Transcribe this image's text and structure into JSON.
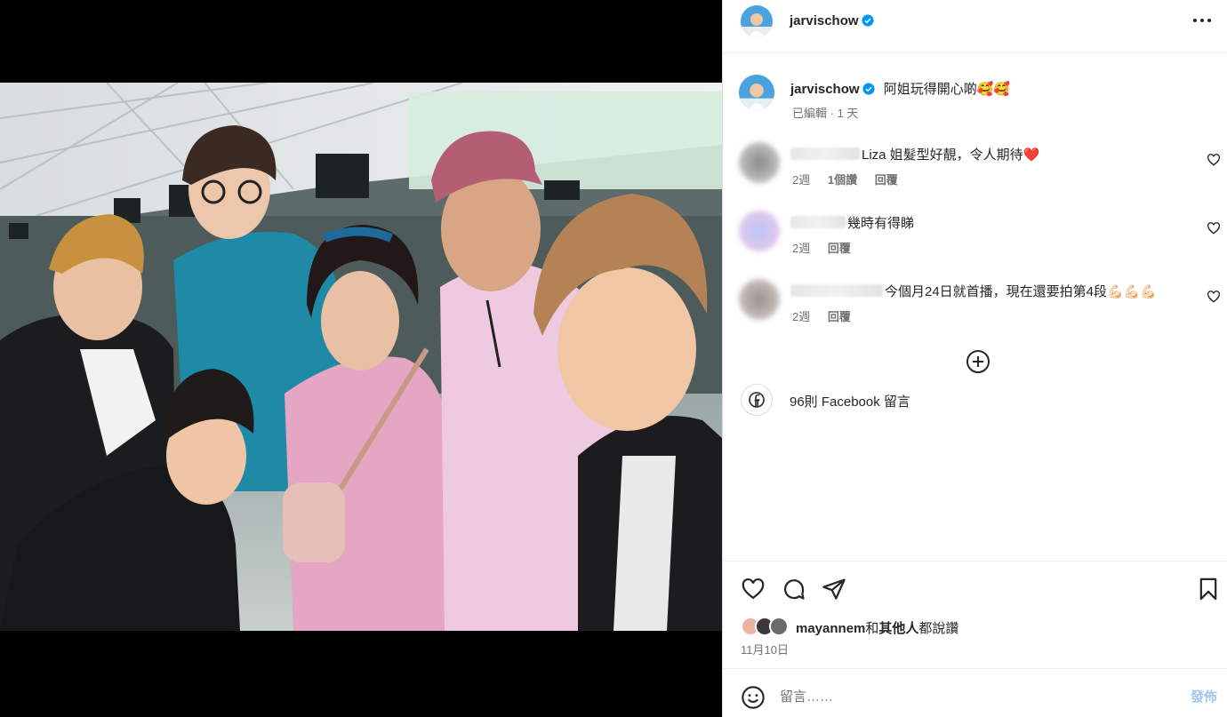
{
  "post": {
    "username": "jarvischow",
    "caption": "阿姐玩得開心啲🥰🥰",
    "edited": "已編輯",
    "separator": " · ",
    "age": "1 天"
  },
  "comments": [
    {
      "text": "Liza 姐髮型好靚，令人期待❤️",
      "age": "2週",
      "likes": "1個讚",
      "reply": "回覆"
    },
    {
      "text": "幾時有得睇",
      "age": "2週",
      "reply": "回覆"
    },
    {
      "text": "今個月24日就首播，現在還要拍第4段💪🏻💪🏻💪🏻",
      "age": "2週",
      "reply": "回覆"
    }
  ],
  "facebook": {
    "text": "96則 Facebook 留言"
  },
  "likes": {
    "user": "mayannem",
    "connector": "和",
    "others": "其他人",
    "suffix": "都說讚"
  },
  "date": "11月10日",
  "composer": {
    "placeholder": "留言……",
    "post_label": "發佈"
  },
  "icons": {
    "more": "more-horizontal-icon",
    "verified": "verified-badge-icon",
    "like": "heart-icon",
    "comment": "comment-icon",
    "share": "share-icon",
    "save": "bookmark-icon",
    "add": "plus-circle-icon",
    "facebook": "facebook-icon",
    "emoji": "emoji-icon"
  },
  "colors": {
    "verified": "#0095f6",
    "post_button": "#a3c7ef",
    "secondary_text": "#737373"
  }
}
